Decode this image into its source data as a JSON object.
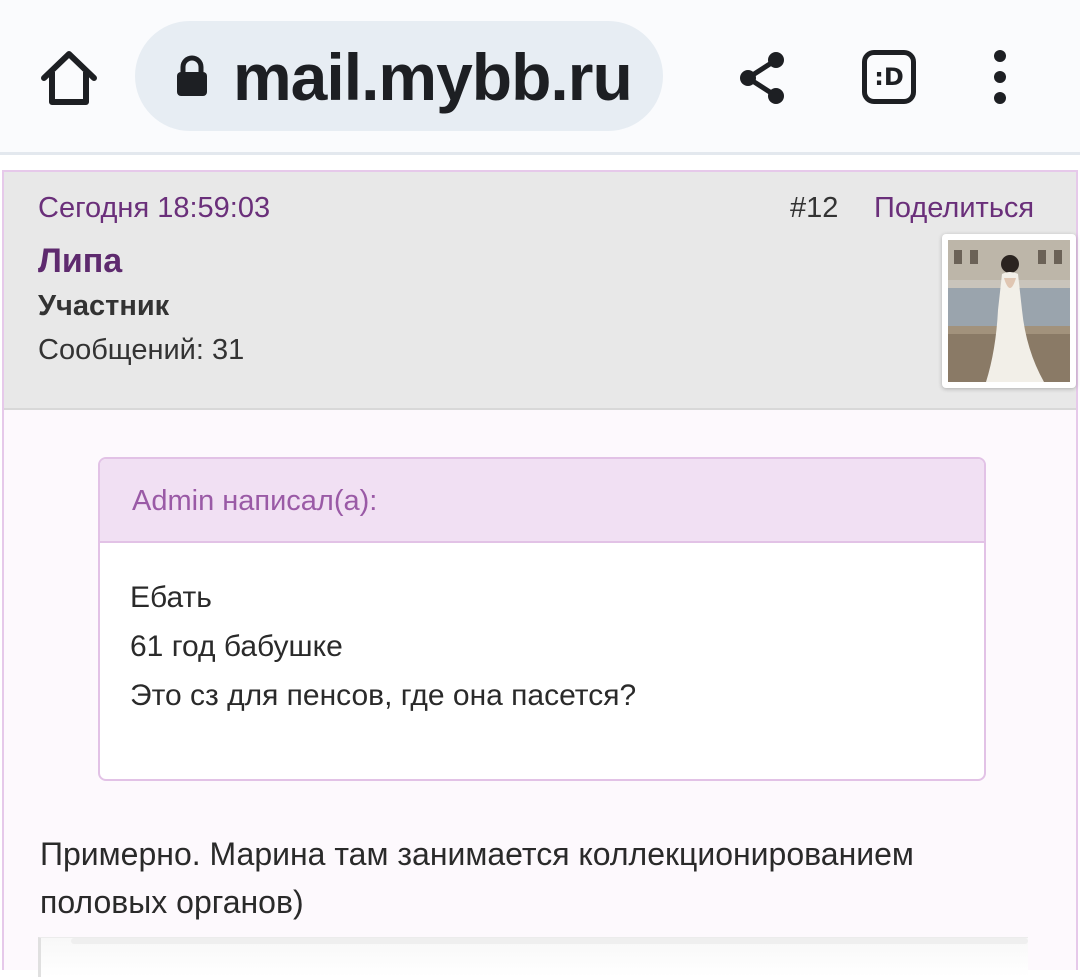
{
  "browser": {
    "url": "mail.mybb.ru",
    "tab_label": ":D"
  },
  "post": {
    "date": "Сегодня 18:59:03",
    "number": "#12",
    "share_label": "Поделиться",
    "author": {
      "name": "Липа",
      "role": "Участник",
      "posts": "Сообщений: 31"
    },
    "quote": {
      "header": "Admin написал(а):",
      "lines": [
        "Ебать",
        "61 год бабушке",
        "Это сз для пенсов, где она пасется?"
      ]
    },
    "reply_lines": [
      "Примерно. Марина там занимается коллекционированием",
      "половых органов)"
    ]
  },
  "colors": {
    "accent": "#6a2f7a",
    "quote_header_bg": "#f1e0f3",
    "header_bg": "#e8e8e8"
  }
}
